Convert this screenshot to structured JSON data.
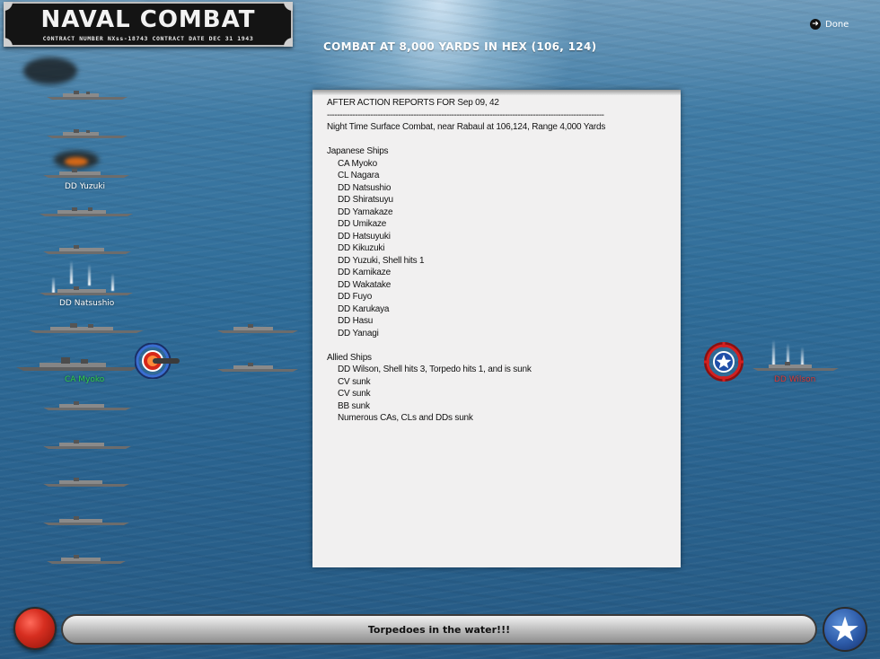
{
  "logo": {
    "title": "NAVAL COMBAT",
    "contract_line": "CONTRACT NUMBER NXss-18743    CONTRACT DATE DEC 31 1943"
  },
  "header": {
    "title": "COMBAT AT 8,000 YARDS IN HEX (106, 124)",
    "done_label": "Done"
  },
  "report": {
    "title": "AFTER ACTION REPORTS FOR Sep 09, 42",
    "separator": "-------------------------------------------------------------------------------------------------------------",
    "summary": "Night Time Surface Combat, near Rabaul at 106,124, Range 4,000 Yards",
    "japanese_heading": "Japanese Ships",
    "japanese_ships": [
      "CA Myoko",
      "CL Nagara",
      "DD Natsushio",
      "DD Shiratsuyu",
      "DD Yamakaze",
      "DD Umikaze",
      "DD Hatsuyuki",
      "DD Kikuzuki",
      "DD Yuzuki, Shell hits 1",
      "DD Kamikaze",
      "DD Wakatake",
      "DD Fuyo",
      "DD Karukaya",
      "DD Hasu",
      "DD Yanagi"
    ],
    "allied_heading": "Allied Ships",
    "allied_ships": [
      "DD Wilson, Shell hits 3, Torpedo hits 1, and is sunk",
      "CV sunk",
      "CV sunk",
      "BB sunk",
      "Numerous CAs, CLs and DDs sunk"
    ]
  },
  "ship_labels": {
    "yuzuki": "DD Yuzuki",
    "natsushio": "DD Natsushio",
    "myoko": "CA Myoko",
    "wilson": "DD Wilson"
  },
  "label_colors": {
    "default": "#ffffff",
    "active": "#2fd04a",
    "enemy": "#d83a3a"
  },
  "status_bar": {
    "message": "Torpedoes in the water!!!"
  }
}
